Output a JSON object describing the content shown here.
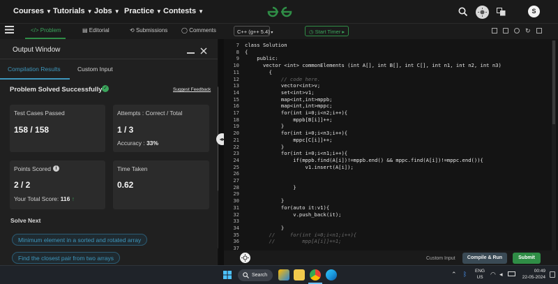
{
  "nav": {
    "items": [
      "Courses",
      "Tutorials",
      "Jobs",
      "Practice",
      "Contests"
    ],
    "logo": "GfG",
    "avatar": "S"
  },
  "tabs": {
    "problem": "Problem",
    "editorial": "Editorial",
    "submissions": "Submissions",
    "comments": "Comments"
  },
  "editor_toolbar": {
    "language": "C++ (g++ 5.4)",
    "start_timer": "Start Timer"
  },
  "output": {
    "title": "Output Window",
    "tab_compile": "Compilation Results",
    "tab_custom": "Custom Input",
    "status": "Problem Solved Successfully",
    "suggest": "Suggest Feedback",
    "tests_label": "Test Cases Passed",
    "tests_value": "158 / 158",
    "attempts_label": "Attempts : Correct / Total",
    "attempts_value": "1 / 3",
    "accuracy_label": "Accuracy :",
    "accuracy_value": "33%",
    "points_label": "Points Scored",
    "points_value": "2 / 2",
    "total_score_label": "Your Total Score:",
    "total_score_value": "116",
    "time_label": "Time Taken",
    "time_value": "0.62",
    "solve_next": "Solve Next",
    "next_1": "Minimum element in a sorted and rotated array",
    "next_2": "Find the closest pair from two arrays"
  },
  "code_lines": [
    {
      "n": "7",
      "t": "class Solution"
    },
    {
      "n": "8",
      "t": "{"
    },
    {
      "n": "9",
      "t": "    public:"
    },
    {
      "n": "10",
      "t": "      vector <int> commonElements (int A[], int B[], int C[], int n1, int n2, int n3)"
    },
    {
      "n": "11",
      "t": "        {"
    },
    {
      "n": "12",
      "t": "            // code here."
    },
    {
      "n": "13",
      "t": "            vector<int>v;"
    },
    {
      "n": "14",
      "t": "            set<int>v1;"
    },
    {
      "n": "15",
      "t": "            map<int,int>mppb;"
    },
    {
      "n": "16",
      "t": "            map<int,int>mppc;"
    },
    {
      "n": "17",
      "t": "            for(int i=0;i<n2;i++){"
    },
    {
      "n": "18",
      "t": "                mppb[B[i]]++;"
    },
    {
      "n": "19",
      "t": "            }"
    },
    {
      "n": "20",
      "t": "            for(int i=0;i<n3;i++){"
    },
    {
      "n": "21",
      "t": "                mppc[C[i]]++;"
    },
    {
      "n": "22",
      "t": "            }"
    },
    {
      "n": "23",
      "t": "            for(int i=0;i<n1;i++){"
    },
    {
      "n": "24",
      "t": "                if(mppb.find(A[i])!=mppb.end() && mppc.find(A[i])!=mppc.end()){"
    },
    {
      "n": "25",
      "t": "                    v1.insert(A[i]);"
    },
    {
      "n": "26",
      "t": ""
    },
    {
      "n": "27",
      "t": ""
    },
    {
      "n": "28",
      "t": "                }"
    },
    {
      "n": "29",
      "t": ""
    },
    {
      "n": "30",
      "t": "            }"
    },
    {
      "n": "31",
      "t": "            for(auto it:v1){"
    },
    {
      "n": "32",
      "t": "                v.push_back(it);"
    },
    {
      "n": "33",
      "t": ""
    },
    {
      "n": "34",
      "t": "            }"
    },
    {
      "n": "35",
      "t": "        //     for(int i=0;i<n1;i++){"
    },
    {
      "n": "36",
      "t": "        //         mpp[A[i]]+=1;"
    },
    {
      "n": "37",
      "t": ""
    }
  ],
  "buttons": {
    "custom_input": "Custom Input",
    "compile_run": "Compile & Run",
    "submit": "Submit"
  },
  "taskbar": {
    "search": "Search",
    "lang1": "ENG",
    "lang2": "US",
    "time": "00:49",
    "date": "22-05-2024"
  },
  "colors": {
    "accent_green": "#2f8d46",
    "link_blue": "#3e97bd",
    "success_green": "#3ba55c"
  }
}
